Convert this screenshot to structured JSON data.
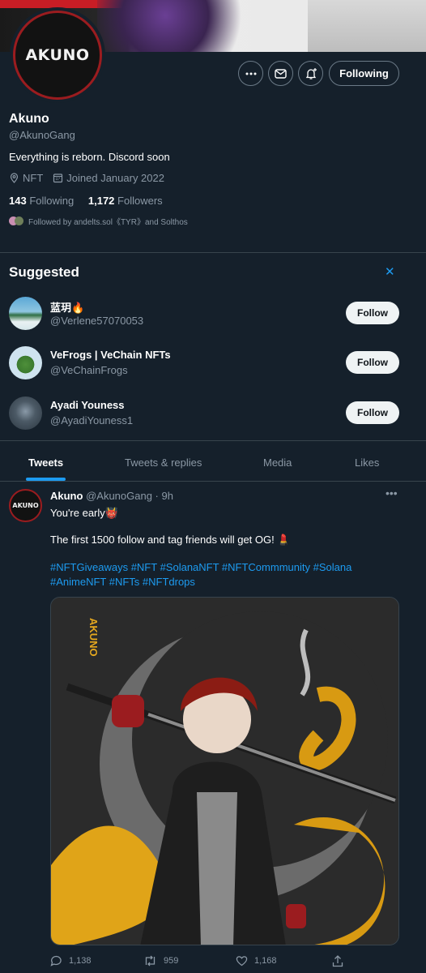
{
  "profile": {
    "banner_name": "AKUNO",
    "name": "Akuno",
    "handle": "@AkunoGang",
    "bio": "Everything is reborn. Discord soon",
    "location": "NFT",
    "joined": "Joined January 2022",
    "following_count": "143",
    "following_label": "Following",
    "followers_count": "1,172",
    "followers_label": "Followers",
    "followed_by": "Followed by andelts.sol《TYR》and Solthos",
    "following_button": "Following"
  },
  "suggested": {
    "title": "Suggested",
    "items": [
      {
        "name": "蓝玥🔥",
        "handle": "@Verlene57070053",
        "button": "Follow"
      },
      {
        "name": "VeFrogs | VeChain NFTs",
        "handle": "@VeChainFrogs",
        "button": "Follow"
      },
      {
        "name": "Ayadi Youness",
        "handle": "@AyadiYouness1",
        "button": "Follow"
      }
    ]
  },
  "tabs": [
    "Tweets",
    "Tweets & replies",
    "Media",
    "Likes"
  ],
  "tweet": {
    "avatar_text": "AKUNO",
    "name": "Akuno",
    "handle_time": "@AkunoGang · 9h",
    "line1": "You're early👹",
    "line2": "The first 1500 follow and tag friends will get OG! 💄",
    "hashtags": "#NFTGiveaways #NFT #SolanaNFT #NFTCommmunity #Solana #AnimeNFT #NFTs #NFTdrops",
    "image_text": "AKUNO",
    "replies": "1,138",
    "retweets": "959",
    "likes": "1,168"
  },
  "colors": {
    "background": "#15202b",
    "accent": "#1d9bf0",
    "muted": "#8b98a5",
    "border": "#38444d"
  }
}
